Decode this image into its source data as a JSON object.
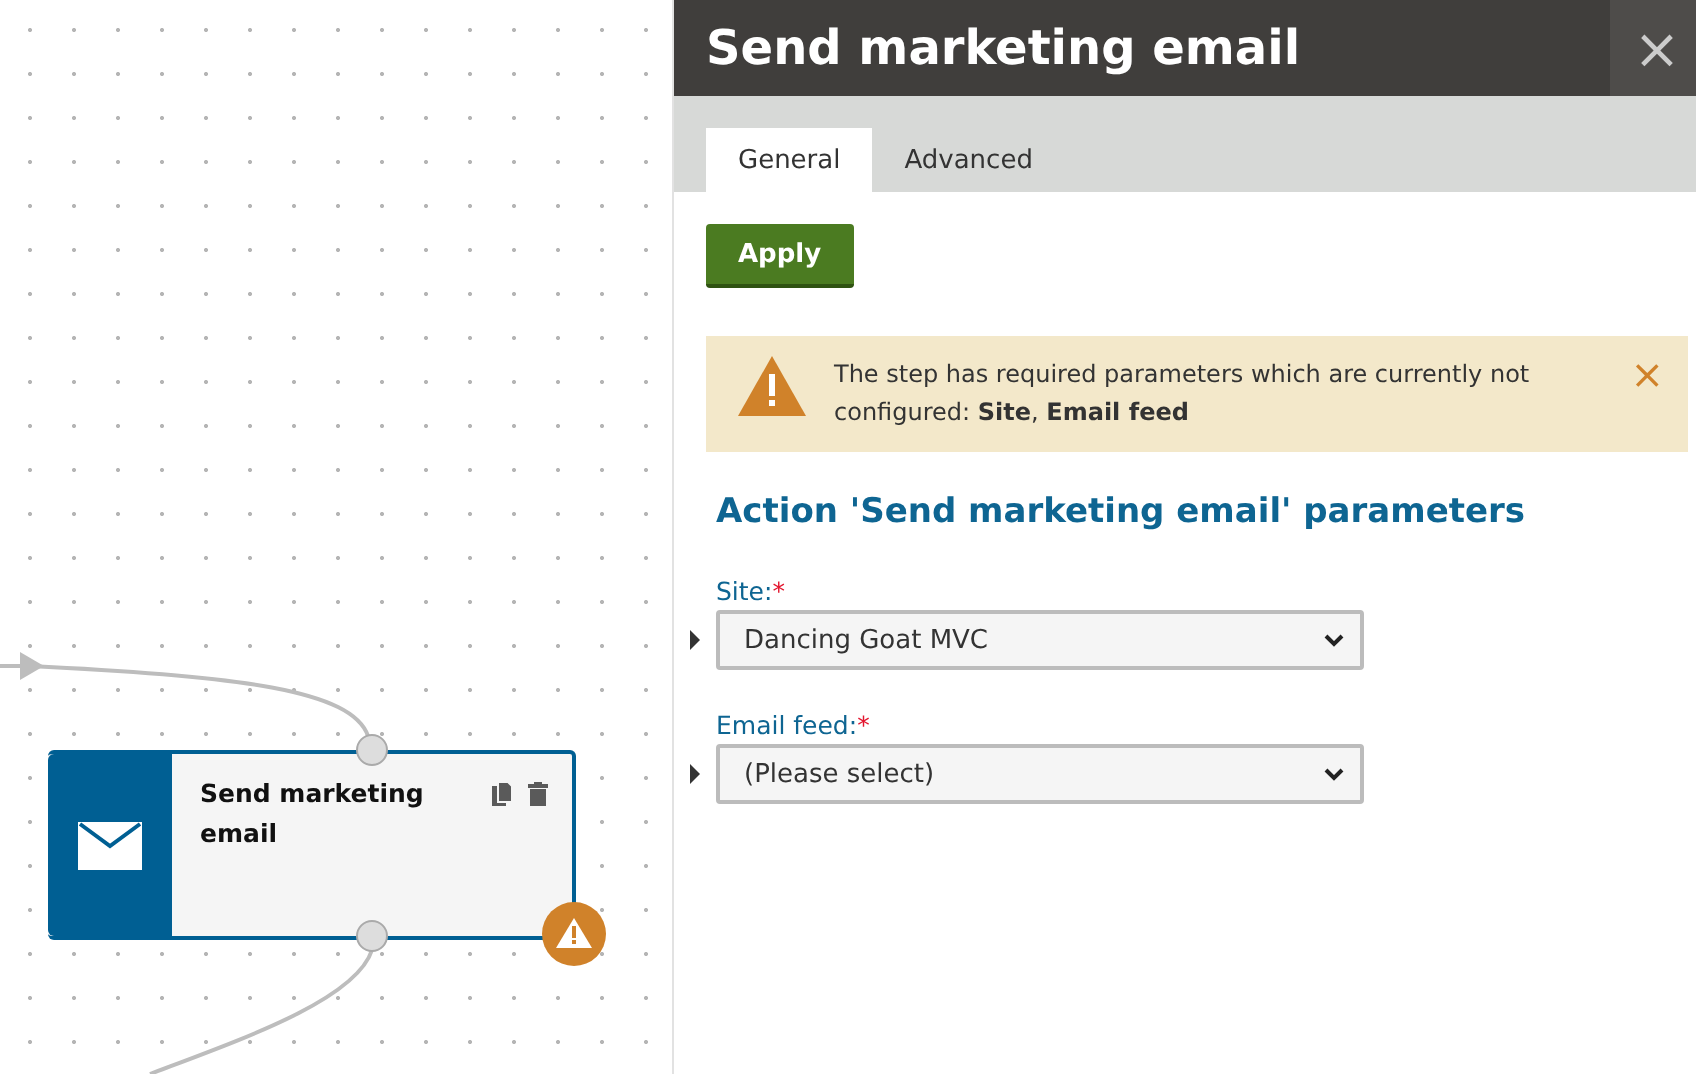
{
  "canvas": {
    "node": {
      "title": "Send marketing email",
      "warning": true
    }
  },
  "panel": {
    "title": "Send marketing email",
    "close": "×",
    "tabs": [
      {
        "label": "General",
        "selected": true
      },
      {
        "label": "Advanced",
        "selected": false
      }
    ],
    "apply_button": "Apply",
    "alert": {
      "message": "The step has required parameters which are currently not configured: **Site**, **Email feed**",
      "dismiss": "×"
    },
    "heading": "Action 'Send marketing email' parameters",
    "fields": [
      {
        "label": "Site:",
        "required_mark": "*",
        "value": "Dancing Goat MVC"
      },
      {
        "label": "Email feed:",
        "required_mark": "*",
        "value": "(Please select)"
      }
    ]
  }
}
